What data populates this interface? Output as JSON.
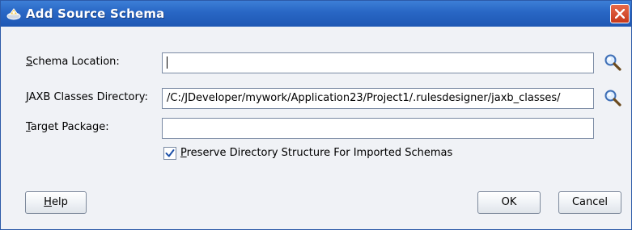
{
  "window": {
    "title": "Add Source Schema",
    "close_glyph": "✕"
  },
  "form": {
    "schema_location": {
      "label_mnemonic": "S",
      "label_rest": "chema Location:",
      "value": ""
    },
    "jaxb_classes_directory": {
      "label_mnemonic": "J",
      "label_rest": "AXB Classes Directory:",
      "value": "/C:/JDeveloper/mywork/Application23/Project1/.rulesdesigner/jaxb_classes/"
    },
    "target_package": {
      "label_mnemonic": "T",
      "label_rest": "arget Package:",
      "value": ""
    },
    "preserve_structure": {
      "checked": true,
      "label_mnemonic": "P",
      "label_rest": "reserve Directory Structure For Imported Schemas"
    }
  },
  "buttons": {
    "help": {
      "mnemonic": "H",
      "rest": "elp"
    },
    "ok": "OK",
    "cancel": "Cancel"
  },
  "icons": {
    "title": "schema-icon",
    "browse": "magnifier-icon",
    "close": "close-icon"
  },
  "colors": {
    "titlebar": "#2866c4",
    "close_button": "#d4492a",
    "dialog_background": "#f0f2f6"
  }
}
